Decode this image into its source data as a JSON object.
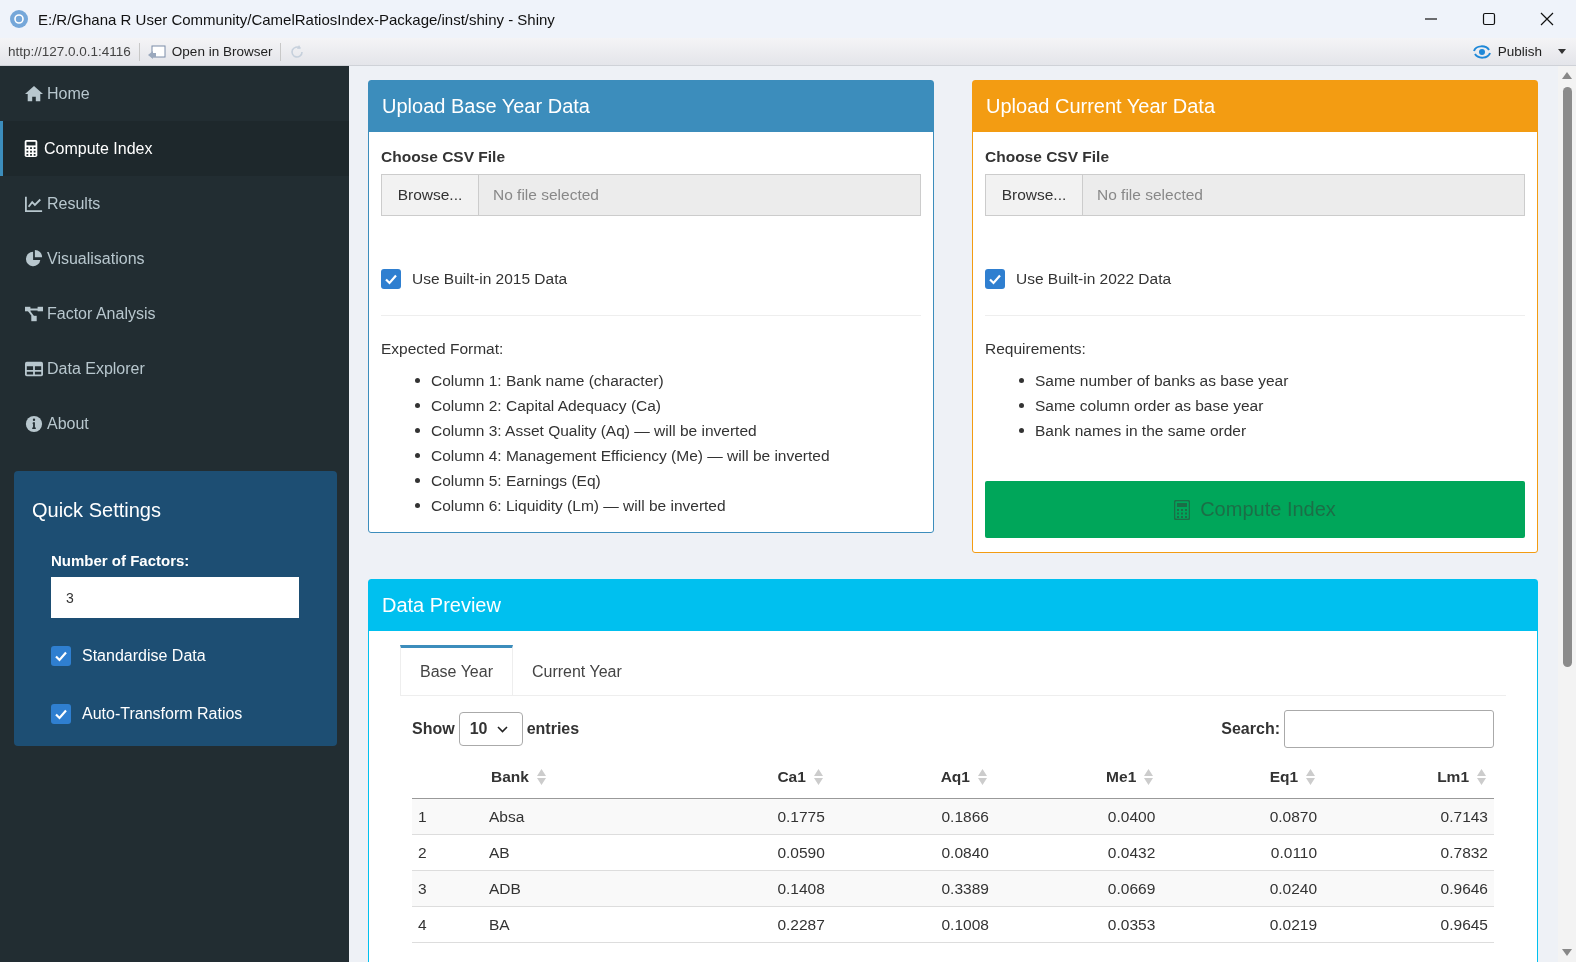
{
  "window": {
    "title": "E:/R/Ghana R User Community/CamelRatiosIndex-Package/inst/shiny - Shiny",
    "url": "http://127.0.0.1:4116",
    "open_in_browser": "Open in Browser",
    "publish": "Publish"
  },
  "sidebar": {
    "items": [
      {
        "label": "Home",
        "selected": false
      },
      {
        "label": "Compute Index",
        "selected": true
      },
      {
        "label": "Results",
        "selected": false
      },
      {
        "label": "Visualisations",
        "selected": false
      },
      {
        "label": "Factor Analysis",
        "selected": false
      },
      {
        "label": "Data Explorer",
        "selected": false
      },
      {
        "label": "About",
        "selected": false
      }
    ],
    "quick_settings": {
      "title": "Quick Settings",
      "factors_label": "Number of Factors:",
      "factors_value": "3",
      "checkboxes": [
        {
          "label": "Standardise Data",
          "checked": true
        },
        {
          "label": "Auto-Transform Ratios",
          "checked": true
        }
      ]
    }
  },
  "upload_panels": [
    {
      "title": "Upload Base Year Data",
      "color": "#3c8dbc",
      "file_label": "Choose CSV File",
      "browse": "Browse...",
      "placeholder": "No file selected",
      "checkbox": {
        "label": "Use Built-in 2015 Data",
        "checked": true
      },
      "list_title": "Expected Format:",
      "items": [
        "Column 1: Bank name (character)",
        "Column 2: Capital Adequacy (Ca)",
        "Column 3: Asset Quality (Aq) — will be inverted",
        "Column 4: Management Efficiency (Me) — will be inverted",
        "Column 5: Earnings (Eq)",
        "Column 6: Liquidity (Lm) — will be inverted"
      ]
    },
    {
      "title": "Upload Current Year Data",
      "color": "#f39c12",
      "file_label": "Choose CSV File",
      "browse": "Browse...",
      "placeholder": "No file selected",
      "checkbox": {
        "label": "Use Built-in 2022 Data",
        "checked": true
      },
      "list_title": "Requirements:",
      "items": [
        "Same number of banks as base year",
        "Same column order as base year",
        "Bank names in the same order"
      ],
      "button": "Compute Index"
    }
  ],
  "preview": {
    "title": "Data Preview",
    "tabs": [
      {
        "label": "Base Year",
        "selected": true
      },
      {
        "label": "Current Year",
        "selected": false
      }
    ],
    "show_label": "Show",
    "length": "10",
    "entries_label": "entries",
    "search_label": "Search:",
    "columns": [
      "",
      "Bank",
      "Ca1",
      "Aq1",
      "Me1",
      "Eq1",
      "Lm1"
    ],
    "rows": [
      [
        "1",
        "Absa",
        "0.1775",
        "0.1866",
        "0.0400",
        "0.0870",
        "0.7143"
      ],
      [
        "2",
        "AB",
        "0.0590",
        "0.0840",
        "0.0432",
        "0.0110",
        "0.7832"
      ],
      [
        "3",
        "ADB",
        "0.1408",
        "0.3389",
        "0.0669",
        "0.0240",
        "0.9646"
      ],
      [
        "4",
        "BA",
        "0.2287",
        "0.1008",
        "0.0353",
        "0.0219",
        "0.9645"
      ]
    ]
  }
}
